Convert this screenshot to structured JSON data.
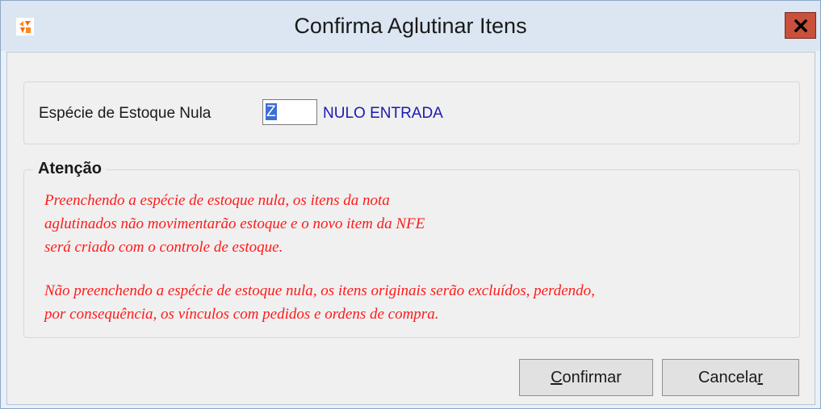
{
  "window": {
    "title": "Confirma Aglutinar Itens",
    "icon": "app-logo-icon",
    "close_icon": "close-icon"
  },
  "especie": {
    "label": "Espécie de Estoque Nula",
    "value": "Z",
    "description": "NULO ENTRADA"
  },
  "attention": {
    "title": "Atenção",
    "message1_lines": [
      "Preenchendo a espécie de estoque nula, os itens da nota",
      "aglutinados não movimentarão estoque e o novo item da NFE",
      "será criado com o controle de estoque."
    ],
    "message2_lines": [
      "Não preenchendo a espécie de estoque nula, os itens originais serão excluídos, perdendo,",
      "por consequência, os vínculos com pedidos e ordens de compra."
    ]
  },
  "buttons": {
    "confirm": {
      "hotkey": "C",
      "rest": "onfirmar"
    },
    "cancel": {
      "before": "Cancela",
      "hotkey": "r"
    }
  },
  "colors": {
    "message": "#ff1a1a",
    "description": "#1a1ab0",
    "close_button": "#c9503b",
    "selection": "#3b6fd6"
  }
}
